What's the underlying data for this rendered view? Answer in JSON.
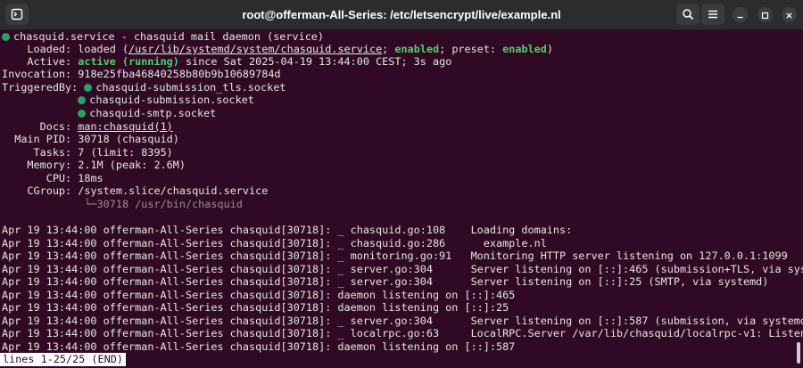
{
  "window": {
    "title": "root@offerman-All-Series: /etc/letsencrypt/live/example.nl"
  },
  "colors": {
    "terminal_bg": "#300a24",
    "titlebar_bg": "#2c2c2c",
    "status_dot": "#26a269",
    "highlight_green": "#4fcf6e"
  },
  "icons": {
    "new_tab": "new-tab-icon",
    "search": "search-icon",
    "menu": "hamburger-menu-icon",
    "minimize": "minimize-icon",
    "maximize": "maximize-icon",
    "close": "close-icon"
  },
  "service": {
    "header": "chasquid.service - chasquid mail daemon (service)",
    "loaded_label": "Loaded:",
    "loaded_pre": "loaded (",
    "loaded_path": "/usr/lib/systemd/system/chasquid.service",
    "loaded_sep": "; ",
    "loaded_enabled": "enabled",
    "loaded_preset_label": "; preset: ",
    "loaded_preset_value": "enabled",
    "loaded_post": ")",
    "active_label": "Active:",
    "active_value": "active (running)",
    "active_since": " since Sat 2025-04-19 13:44:00 CEST; 3s ago",
    "invocation_label": "Invocation:",
    "invocation_value": "918e25fba46840258b80b9b10689784d",
    "triggeredby_label": "TriggeredBy:",
    "triggers": [
      "chasquid-submission_tls.socket",
      "chasquid-submission.socket",
      "chasquid-smtp.socket"
    ],
    "docs_label": "Docs:",
    "docs_value": "man:chasquid(1)",
    "mainpid_label": "Main PID:",
    "mainpid_value": "30718 (chasquid)",
    "tasks_label": "Tasks:",
    "tasks_value": "7 (limit: 8395)",
    "memory_label": "Memory:",
    "memory_value": "2.1M (peak: 2.6M)",
    "cpu_label": "CPU:",
    "cpu_value": "18ms",
    "cgroup_label": "CGroup:",
    "cgroup_value": "/system.slice/chasquid.service",
    "cgroup_tree": "└─30718 /usr/bin/chasquid"
  },
  "log": [
    "Apr 19 13:44:00 offerman-All-Series chasquid[30718]: _ chasquid.go:108    Loading domains:",
    "Apr 19 13:44:00 offerman-All-Series chasquid[30718]: _ chasquid.go:286      example.nl",
    "Apr 19 13:44:00 offerman-All-Series chasquid[30718]: _ monitoring.go:91   Monitoring HTTP server listening on 127.0.0.1:1099",
    "Apr 19 13:44:00 offerman-All-Series chasquid[30718]: _ server.go:304      Server listening on [::]:465 (submission+TLS, via systemd)",
    "Apr 19 13:44:00 offerman-All-Series chasquid[30718]: _ server.go:304      Server listening on [::]:25 (SMTP, via systemd)",
    "Apr 19 13:44:00 offerman-All-Series chasquid[30718]: daemon listening on [::]:465",
    "Apr 19 13:44:00 offerman-All-Series chasquid[30718]: daemon listening on [::]:25",
    "Apr 19 13:44:00 offerman-All-Series chasquid[30718]: _ server.go:304      Server listening on [::]:587 (submission, via systemd)",
    "Apr 19 13:44:00 offerman-All-Series chasquid[30718]: _ localrpc.go:63     LocalRPC.Server /var/lib/chasquid/localrpc-v1: Listening",
    "Apr 19 13:44:00 offerman-All-Series chasquid[30718]: daemon listening on [::]:587"
  ],
  "pager": {
    "status": "lines 1-25/25 (END)"
  }
}
